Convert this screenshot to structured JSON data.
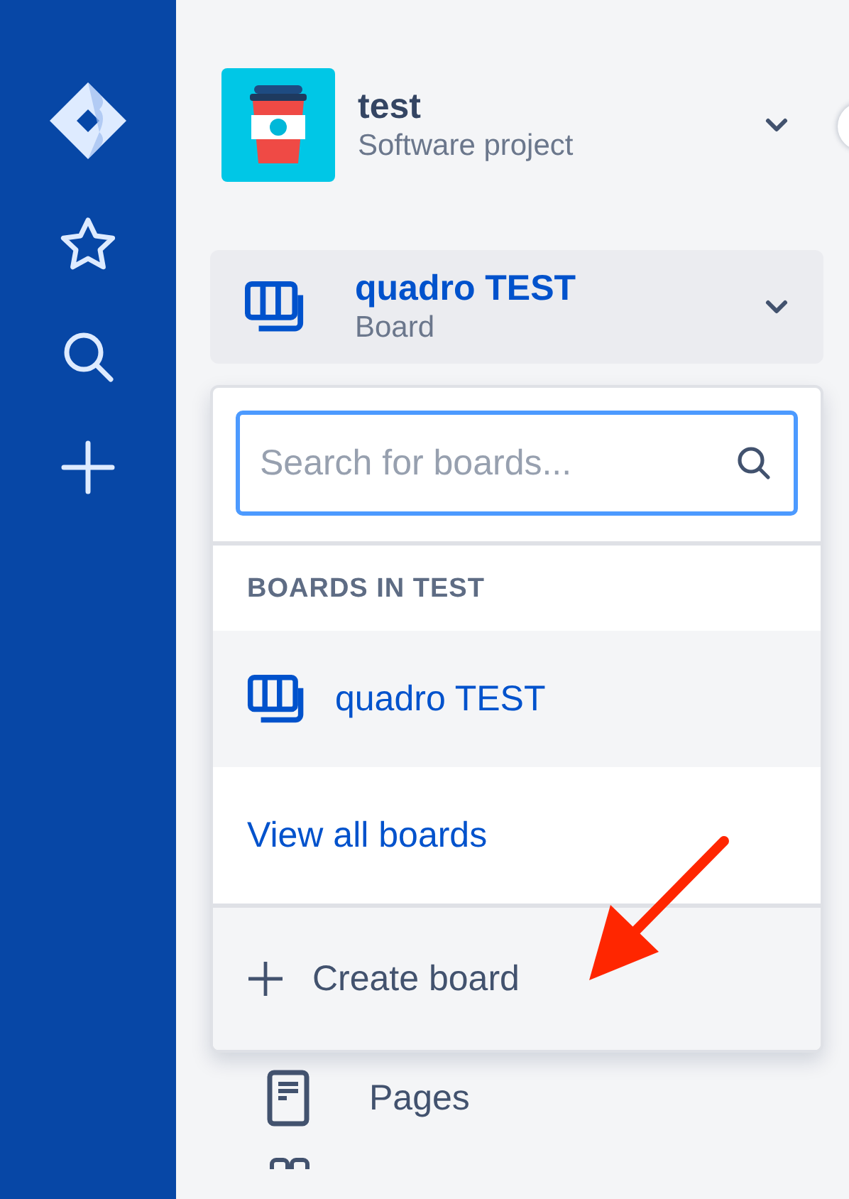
{
  "project": {
    "name": "test",
    "type": "Software project"
  },
  "board_switcher": {
    "name": "quadro TEST",
    "type": "Board"
  },
  "board_dropdown": {
    "search": {
      "placeholder": "Search for boards..."
    },
    "section_heading": "BOARDS IN TEST",
    "boards": [
      {
        "label": "quadro TEST"
      }
    ],
    "view_all_link": "View all boards",
    "create_button": "Create board"
  },
  "nav_items": [
    {
      "label": "Pages"
    }
  ]
}
